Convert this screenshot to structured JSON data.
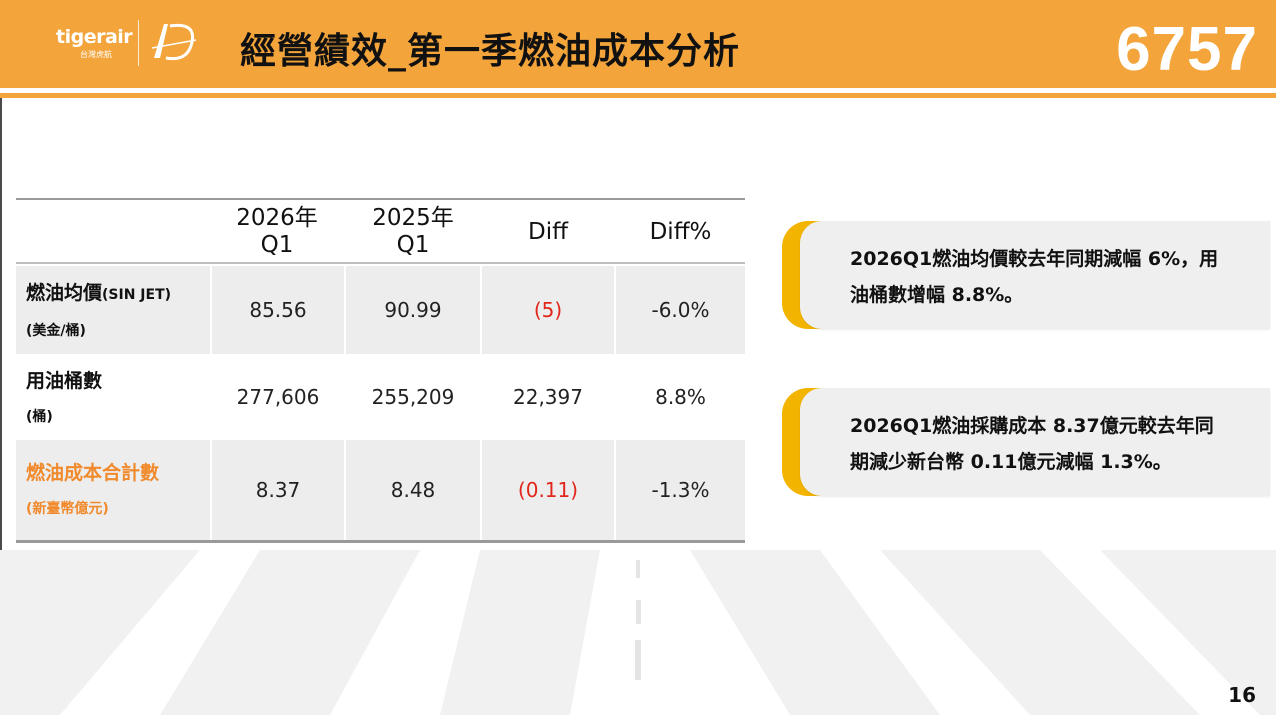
{
  "header": {
    "logo_text": "tigerair",
    "logo_sub": "台灣虎航",
    "anniversary_mark": "10",
    "title": "經營績效_第一季燃油成本分析",
    "stock_code": "6757"
  },
  "table": {
    "columns": [
      "2026年\nQ1",
      "2025年\nQ1",
      "Diff",
      "Diff%"
    ],
    "column_lines": [
      [
        "2026年",
        "Q1"
      ],
      [
        "2025年",
        "Q1"
      ],
      [
        "Diff"
      ],
      [
        "Diff%"
      ]
    ],
    "rows": [
      {
        "label_main": "燃油均價",
        "label_suffix": "(SIN JET)",
        "label_unit": "(美金/桶)",
        "values": [
          "85.56",
          "90.99",
          "(5)",
          "-6.0%"
        ]
      },
      {
        "label_main": "用油桶數",
        "label_suffix": "",
        "label_unit": "(桶)",
        "values": [
          "277,606",
          "255,209",
          "22,397",
          "8.8%"
        ]
      },
      {
        "label_main": "燃油成本合計數",
        "label_suffix": "",
        "label_unit": "(新臺幣億元)",
        "values": [
          "8.37",
          "8.48",
          "(0.11)",
          "-1.3%"
        ]
      }
    ]
  },
  "callouts": [
    {
      "text_line1": "2026Q1燃油均價較去年同期減幅 6%，用",
      "text_line2": "油桶數增幅 8.8%。"
    },
    {
      "text_line1": "2026Q1燃油採購成本 8.37億元較去年同",
      "text_line2": "期減少新台幣 0.11億元減幅 1.3%。"
    }
  ],
  "page_number": "16",
  "colors": {
    "accent_orange": "#f3a53c",
    "callout_yellow": "#f3b400",
    "negative_red": "#e1261c",
    "highlight_orange": "#f08a2c"
  }
}
